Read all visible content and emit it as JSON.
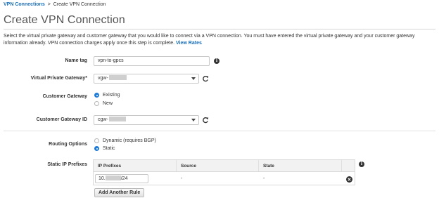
{
  "breadcrumb": {
    "parent": "VPN Connections",
    "separator": ">",
    "current": "Create VPN Connection"
  },
  "page": {
    "title": "Create VPN Connection",
    "intro_text": "Select the virtual private gateway and customer gateway that you would like to connect via a VPN connection. You must have entered the virtual private gateway and your customer gateway information already. VPN connection charges apply once this step is complete.",
    "intro_link": "View Rates"
  },
  "form": {
    "name_tag": {
      "label": "Name tag",
      "value": "vpn-to-gpcs"
    },
    "vpg": {
      "label": "Virtual Private Gateway*",
      "value": "vgw-"
    },
    "customer_gateway": {
      "label": "Customer Gateway",
      "options": [
        "Existing",
        "New"
      ],
      "selected": "Existing"
    },
    "customer_gateway_id": {
      "label": "Customer Gateway ID",
      "value": "cgw-"
    },
    "routing": {
      "label": "Routing Options",
      "options": [
        "Dynamic (requires BGP)",
        "Static"
      ],
      "selected": "Static"
    },
    "static_ip": {
      "label": "Static IP Prefixes",
      "columns": [
        "IP Prefixes",
        "Source",
        "State"
      ],
      "rows": [
        {
          "prefix_start": "10.",
          "prefix_end": "/24",
          "source": "-",
          "state": "-"
        }
      ],
      "add_button": "Add Another Rule"
    }
  },
  "icons": {
    "info": "info-icon",
    "refresh": "refresh-icon",
    "remove": "remove-icon",
    "dropdown": "chevron-down-icon"
  },
  "colors": {
    "link": "#1a6fb8",
    "radio_selected": "#1f7bd6",
    "text": "#333333",
    "title": "#555555"
  }
}
